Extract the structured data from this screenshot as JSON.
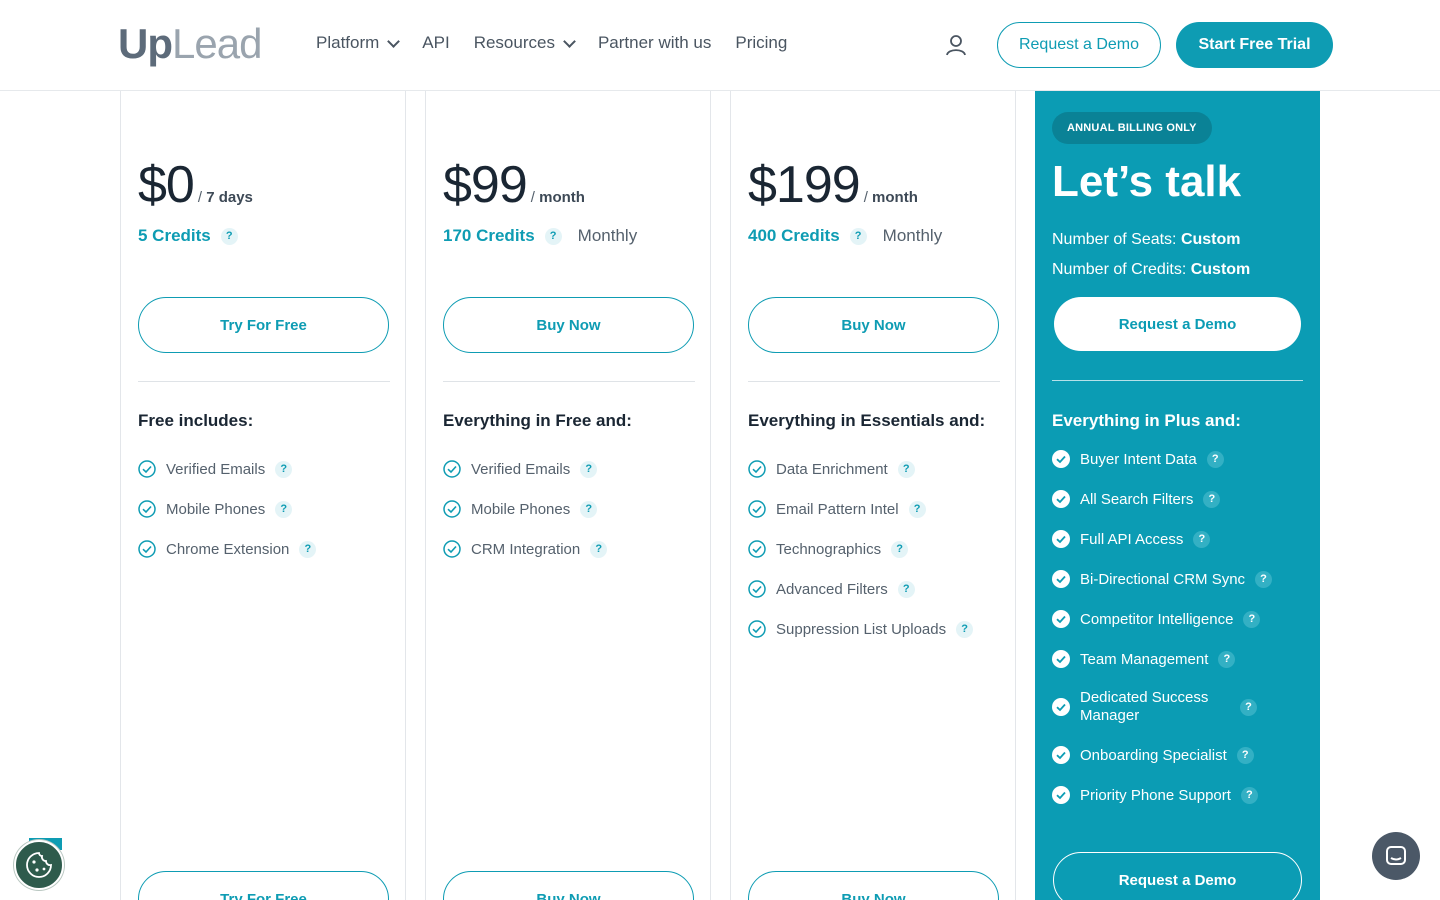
{
  "header": {
    "logo_up": "Up",
    "logo_lead": "Lead",
    "nav": [
      {
        "label": "Platform",
        "dropdown": true
      },
      {
        "label": "API",
        "dropdown": false
      },
      {
        "label": "Resources",
        "dropdown": true
      },
      {
        "label": "Partner with us",
        "dropdown": false
      },
      {
        "label": "Pricing",
        "dropdown": false
      }
    ],
    "demo_label": "Request a Demo",
    "trial_label": "Start Free Trial"
  },
  "plans": [
    {
      "price": "$0",
      "period": "7 days",
      "credits": "5 Credits",
      "billing": "",
      "cta": "Try For Free",
      "features_title": "Free includes:",
      "features": [
        "Verified Emails",
        "Mobile Phones",
        "Chrome Extension"
      ]
    },
    {
      "price": "$99",
      "period": "month",
      "credits": "170 Credits",
      "billing": "Monthly",
      "cta": "Buy Now",
      "features_title": "Everything in Free and:",
      "features": [
        "Verified Emails",
        "Mobile Phones",
        "CRM Integration"
      ]
    },
    {
      "price": "$199",
      "period": "month",
      "credits": "400 Credits",
      "billing": "Monthly",
      "cta": "Buy Now",
      "features_title": "Everything in Essentials and:",
      "features": [
        "Data Enrichment",
        "Email Pattern Intel",
        "Technographics",
        "Advanced Filters",
        "Suppression List Uploads"
      ]
    }
  ],
  "enterprise": {
    "badge": "ANNUAL BILLING ONLY",
    "title": "Let’s talk",
    "seats_label": "Number of Seats:",
    "seats_value": "Custom",
    "credits_label": "Number of Credits:",
    "credits_value": "Custom",
    "cta": "Request a Demo",
    "features_title": "Everything in Plus and:",
    "features": [
      "Buyer Intent Data",
      "All Search Filters",
      "Full API Access",
      "Bi-Directional CRM Sync",
      "Competitor Intelligence",
      "Team Management",
      "Dedicated Success Manager",
      "Onboarding Specialist",
      "Priority Phone Support"
    ]
  },
  "help_glyph": "?",
  "colors": {
    "brand": "#0e9cb3",
    "enterprise_bg": "#0b9cb4",
    "text_dark": "#1a2633"
  },
  "icons": {
    "user": "user-icon",
    "check": "check-circle-icon",
    "cookie": "cookie-icon",
    "chat": "chat-icon"
  }
}
